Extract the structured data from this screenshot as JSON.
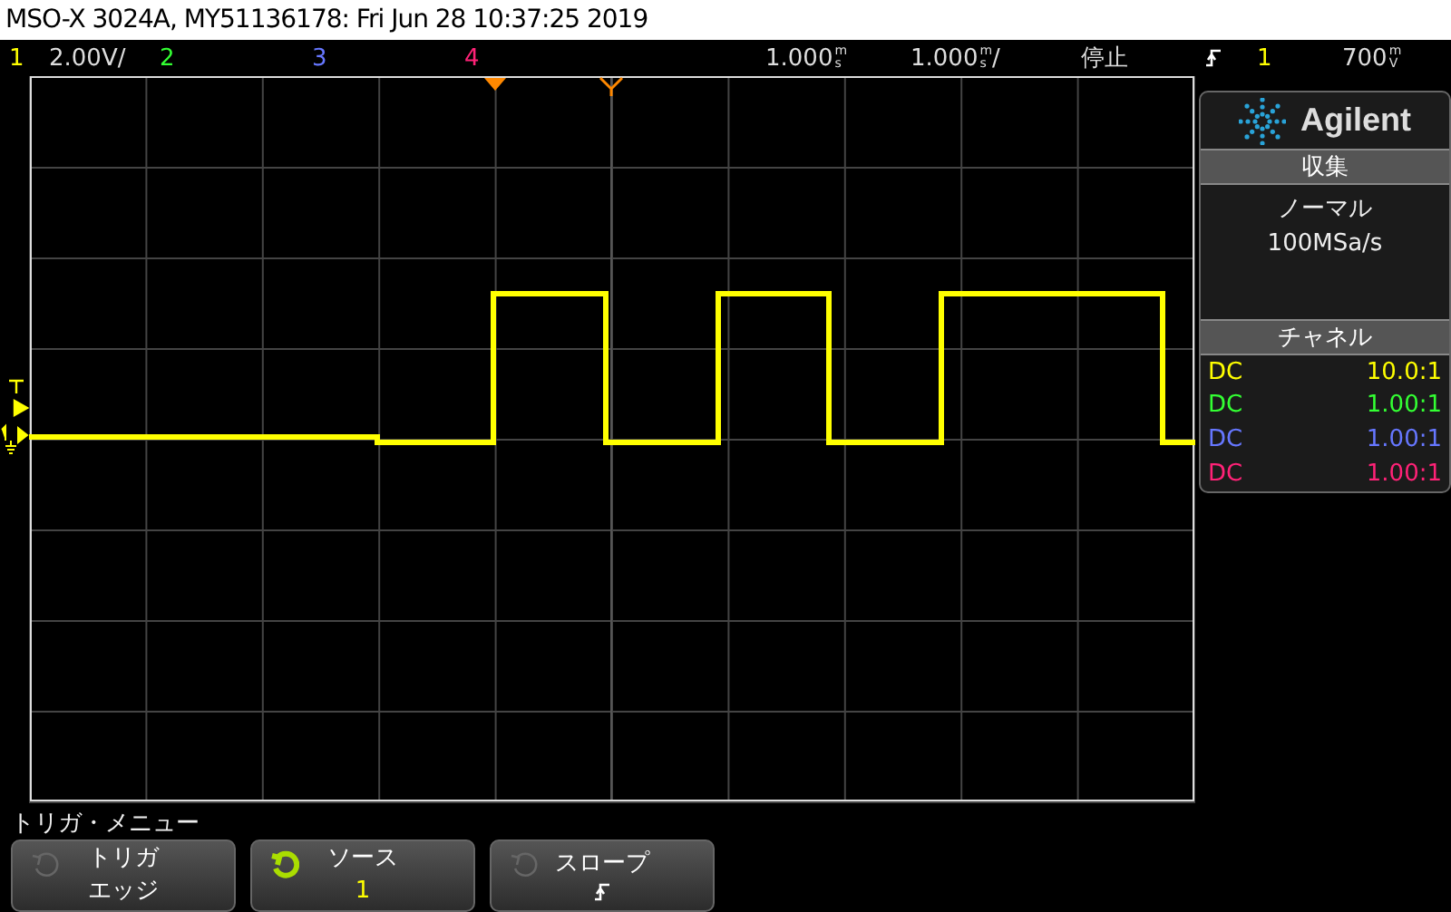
{
  "window": {
    "title": "MSO-X 3024A, MY51136178: Fri Jun 28 10:37:25 2019"
  },
  "status_bar": {
    "channels": [
      {
        "number": "1",
        "color": "#ffff00",
        "scale": "2.00V/"
      },
      {
        "number": "2",
        "color": "#33ff33"
      },
      {
        "number": "3",
        "color": "#6677ff"
      },
      {
        "number": "4",
        "color": "#ff2277"
      }
    ],
    "delay": {
      "value": "1.000",
      "unit_top": "m",
      "unit_bottom": "s"
    },
    "timebase": {
      "value": "1.000",
      "unit_top": "m",
      "unit_bottom": "s",
      "suffix": "/"
    },
    "run_state": "停止",
    "trigger_source": "1",
    "trigger_level": {
      "value": "700",
      "unit_top": "m",
      "unit_bottom": "V"
    }
  },
  "side_panel": {
    "brand": "Agilent",
    "acquisition": {
      "title": "収集",
      "mode": "ノーマル",
      "rate": "100MSa/s"
    },
    "channels_title": "チャネル",
    "channels": [
      {
        "coupling": "DC",
        "probe": "10.0:1",
        "color": "#ffff00"
      },
      {
        "coupling": "DC",
        "probe": "1.00:1",
        "color": "#33ff33"
      },
      {
        "coupling": "DC",
        "probe": "1.00:1",
        "color": "#6677ff"
      },
      {
        "coupling": "DC",
        "probe": "1.00:1",
        "color": "#ff2277"
      }
    ]
  },
  "menu": {
    "title": "トリガ・メニュー",
    "softkeys": [
      {
        "label": "トリガ",
        "value": "エッジ",
        "kind": "text",
        "active": false
      },
      {
        "label": "ソース",
        "value": "1",
        "kind": "text",
        "active": true
      },
      {
        "label": "スロープ",
        "kind": "slope",
        "active": false
      }
    ]
  }
}
